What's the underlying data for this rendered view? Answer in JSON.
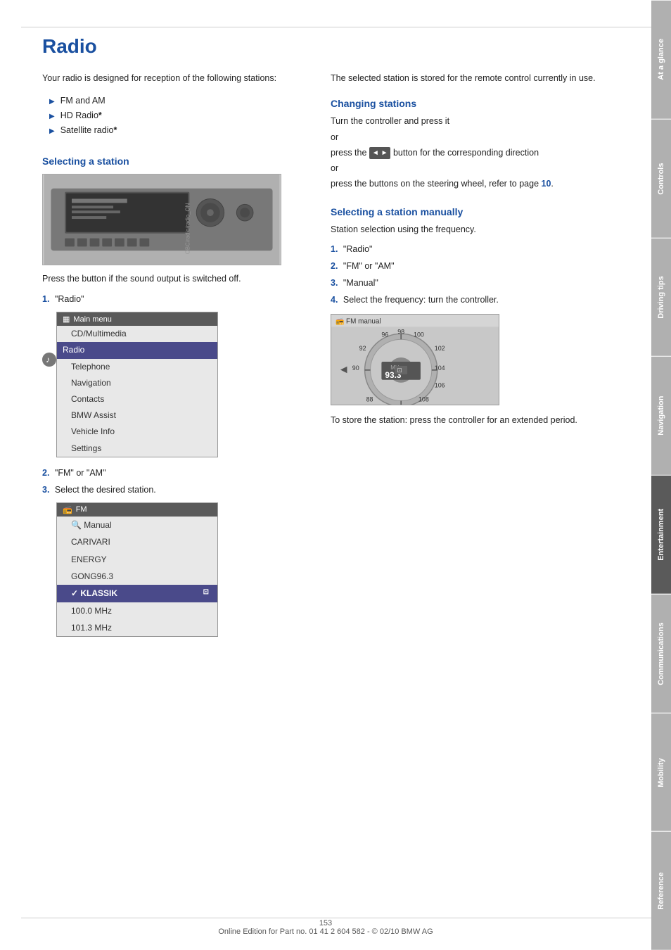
{
  "page": {
    "title": "Radio",
    "page_number": "153",
    "footer_text": "Online Edition for Part no. 01 41 2 604 582 - © 02/10 BMW AG"
  },
  "sidebar": {
    "tabs": [
      {
        "id": "at-a-glance",
        "label": "At a glance",
        "active": false
      },
      {
        "id": "controls",
        "label": "Controls",
        "active": false
      },
      {
        "id": "driving-tips",
        "label": "Driving tips",
        "active": false
      },
      {
        "id": "navigation",
        "label": "Navigation",
        "active": false
      },
      {
        "id": "entertainment",
        "label": "Entertainment",
        "active": true
      },
      {
        "id": "communications",
        "label": "Communications",
        "active": false
      },
      {
        "id": "mobility",
        "label": "Mobility",
        "active": false
      },
      {
        "id": "reference",
        "label": "Reference",
        "active": false
      }
    ]
  },
  "left_column": {
    "intro": "Your radio is designed for reception of the following stations:",
    "bullet_items": [
      {
        "text": "FM and AM",
        "bold_part": ""
      },
      {
        "text": "HD Radio",
        "bold_part": "*"
      },
      {
        "text": "Satellite radio",
        "bold_part": "*"
      }
    ],
    "section_heading": "Selecting a station",
    "press_text": "Press the button if the sound output is switched off.",
    "step1": {
      "num": "1.",
      "text": "\"Radio\""
    },
    "main_menu": {
      "title": "Main menu",
      "title_icon": "☰",
      "items": [
        {
          "text": "CD/Multimedia",
          "highlighted": false
        },
        {
          "text": "Radio",
          "highlighted": true
        },
        {
          "text": "Telephone",
          "highlighted": false
        },
        {
          "text": "Navigation",
          "highlighted": false
        },
        {
          "text": "Contacts",
          "highlighted": false
        },
        {
          "text": "BMW Assist",
          "highlighted": false
        },
        {
          "text": "Vehicle Info",
          "highlighted": false
        },
        {
          "text": "Settings",
          "highlighted": false
        }
      ]
    },
    "step2": {
      "num": "2.",
      "text": "\"FM\" or \"AM\""
    },
    "step3": {
      "num": "3.",
      "text": "Select the desired station."
    },
    "fm_list": {
      "title": "FM",
      "title_icon": "📻",
      "items": [
        {
          "text": "Manual",
          "icon": "🔍",
          "selected": false
        },
        {
          "text": "CARIVARI",
          "selected": false
        },
        {
          "text": "ENERGY",
          "selected": false
        },
        {
          "text": "GONG96.3",
          "selected": false
        },
        {
          "text": "KLASSIK",
          "selected": true,
          "badge": true
        },
        {
          "text": "100.0 MHz",
          "selected": false
        },
        {
          "text": "101.3 MHz",
          "selected": false
        }
      ]
    }
  },
  "right_column": {
    "store_text": "The selected station is stored for the remote control currently in use.",
    "changing_stations": {
      "heading": "Changing stations",
      "text1": "Turn the controller and press it",
      "or1": "or",
      "text2": "press the",
      "button_label": "◄ ►",
      "text2b": "button for the corresponding direction",
      "or2": "or",
      "text3": "press the buttons on the steering wheel, refer to page",
      "page_link": "10",
      "text3b": "."
    },
    "selecting_manually": {
      "heading": "Selecting a station manually",
      "intro": "Station selection using the frequency.",
      "steps": [
        {
          "num": "1.",
          "text": "\"Radio\""
        },
        {
          "num": "2.",
          "text": "\"FM\" or \"AM\""
        },
        {
          "num": "3.",
          "text": "\"Manual\""
        },
        {
          "num": "4.",
          "text": "Select the frequency: turn the controller."
        }
      ],
      "fm_manual_title": "FM manual",
      "store_text": "To store the station: press the controller for an extended period.",
      "dial_labels": {
        "top": [
          "96",
          "98",
          "100"
        ],
        "right": [
          "102",
          "104",
          "106",
          "108"
        ],
        "bottom": [
          "88"
        ],
        "center_mhz": "MHz",
        "center_val": "93.3",
        "left_arrow": "◄"
      }
    }
  }
}
